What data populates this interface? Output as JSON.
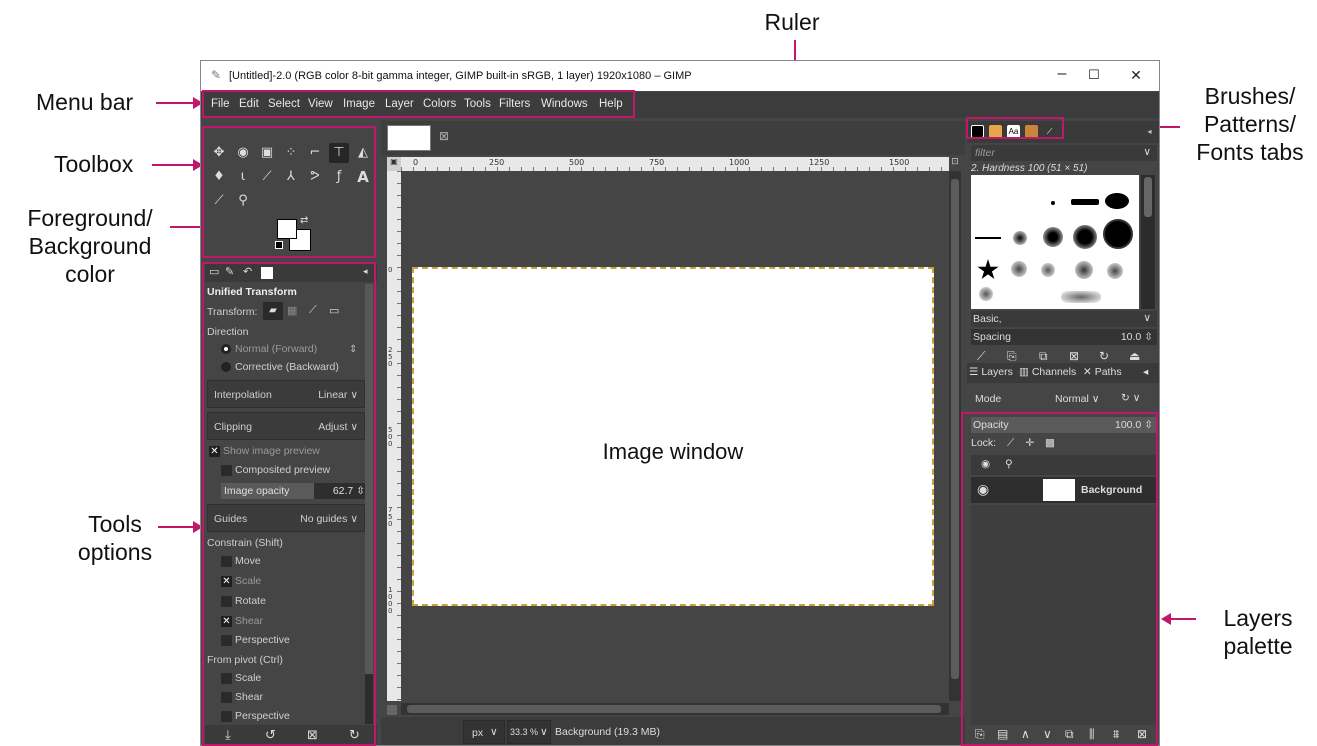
{
  "callouts": {
    "ruler": "Ruler",
    "menu_bar": "Menu bar",
    "toolbox": "Toolbox",
    "fg_bg_1": "Foreground/",
    "fg_bg_2": "Background",
    "fg_bg_3": "color",
    "tools_options_1": "Tools",
    "tools_options_2": "options",
    "brushes_1": "Brushes/",
    "brushes_2": "Patterns/",
    "brushes_3": "Fonts tabs",
    "layers_1": "Layers",
    "layers_2": "palette",
    "image_window": "Image window"
  },
  "window": {
    "title": "[Untitled]-2.0 (RGB color 8-bit gamma integer, GIMP built-in sRGB, 1 layer) 1920x1080 – GIMP",
    "minimize": "–",
    "maximize": "☐",
    "close": "✕"
  },
  "menu": [
    "File",
    "Edit",
    "Select",
    "View",
    "Image",
    "Layer",
    "Colors",
    "Tools",
    "Filters",
    "Windows",
    "Help"
  ],
  "ruler": {
    "h_labels": [
      "0",
      "250",
      "500",
      "750",
      "1000",
      "1250",
      "1500"
    ],
    "v_labels": [
      "0",
      "2 5 0",
      "5 0 0",
      "7 5 0",
      "1 0 0 0"
    ]
  },
  "tool_options": {
    "title": "Unified Transform",
    "transform_label": "Transform:",
    "direction_label": "Direction",
    "normal": "Normal (Forward)",
    "corrective": "Corrective (Backward)",
    "interpolation_label": "Interpolation",
    "interpolation_value": "Linear",
    "clipping_label": "Clipping",
    "clipping_value": "Adjust",
    "show_preview": "Show image preview",
    "composited_preview": "Composited preview",
    "opacity_label": "Image opacity",
    "opacity_value": "62.7",
    "opacity_fraction": 0.627,
    "guides_label": "Guides",
    "guides_value": "No guides",
    "constrain_label": "Constrain (Shift)",
    "move": "Move",
    "scale": "Scale",
    "rotate": "Rotate",
    "shear": "Shear",
    "perspective": "Perspective",
    "pivot_label": "From pivot  (Ctrl)",
    "pivot_scale": "Scale",
    "pivot_shear": "Shear",
    "pivot_perspective": "Perspective"
  },
  "status": {
    "unit": "px",
    "zoom": "33.3 %",
    "layer_info": "Background (19.3 MB)"
  },
  "brushes": {
    "filter_placeholder": "filter",
    "current_brush": "2. Hardness 100 (51 × 51)",
    "tag": "Basic,",
    "spacing_label": "Spacing",
    "spacing_value": "10.0"
  },
  "layers": {
    "tab_layers": "Layers",
    "tab_channels": "Channels",
    "tab_paths": "Paths",
    "mode_label": "Mode",
    "mode_value": "Normal",
    "opacity_label": "Opacity",
    "opacity_value": "100.0",
    "lock_label": "Lock:",
    "layer_name": "Background"
  }
}
